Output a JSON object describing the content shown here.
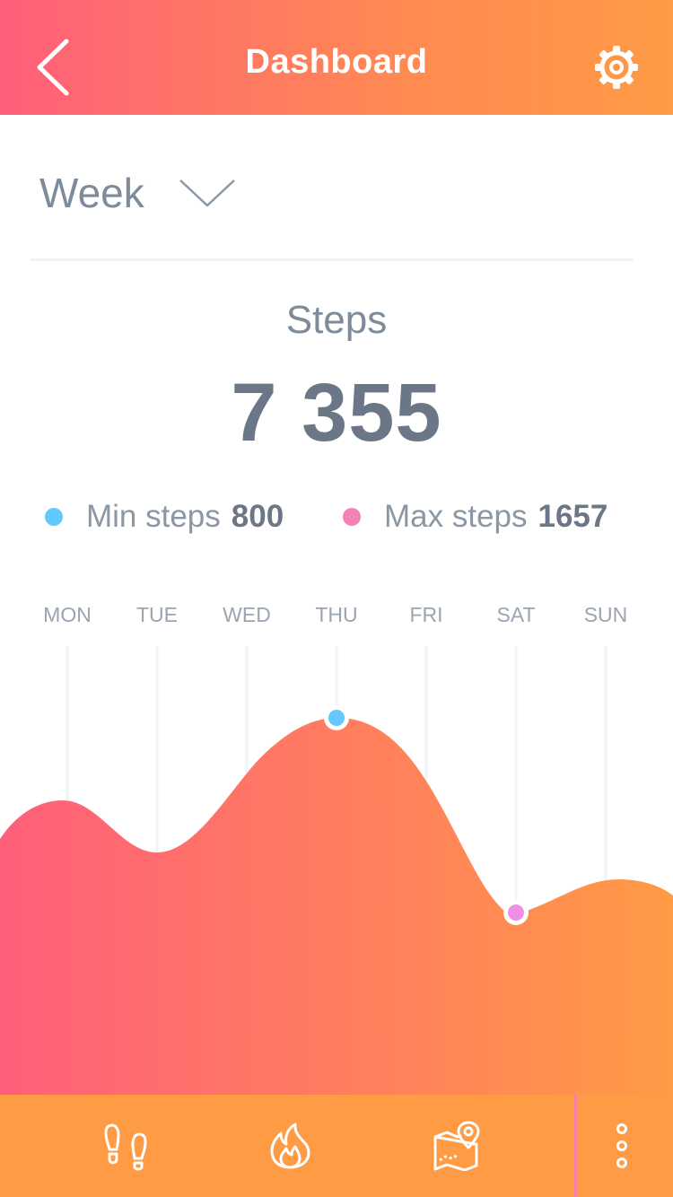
{
  "header": {
    "title": "Dashboard",
    "back_icon": "chevron-left-icon",
    "settings_icon": "gear-icon"
  },
  "period": {
    "selected": "Week",
    "chevron_icon": "chevron-down-icon"
  },
  "summary": {
    "label": "Steps",
    "value": "7 355"
  },
  "legend": {
    "min": {
      "label": "Min steps",
      "value": "800",
      "color": "#63c8fb"
    },
    "max": {
      "label": "Max steps",
      "value": "1657",
      "color": "#f283b6"
    }
  },
  "chart_data": {
    "type": "area",
    "categories": [
      "MON",
      "TUE",
      "WED",
      "THU",
      "FRI",
      "SAT",
      "SUN"
    ],
    "markers": [
      {
        "category": "THU",
        "color": "#63c8fb"
      },
      {
        "category": "SAT",
        "color": "#ee8fe4"
      }
    ],
    "gradient": [
      "#ff5f7a",
      "#ff9a45"
    ],
    "grid": true,
    "y_axis_labels": false
  },
  "bottom_nav": {
    "items": [
      {
        "name": "steps",
        "icon": "footprints-icon"
      },
      {
        "name": "calories",
        "icon": "flame-icon"
      },
      {
        "name": "map",
        "icon": "map-pin-icon"
      }
    ],
    "more_icon": "more-vertical-icon"
  },
  "colors": {
    "accent_start": "#ff5f7a",
    "accent_end": "#ff9a45",
    "text_muted": "#7e8b9a"
  }
}
